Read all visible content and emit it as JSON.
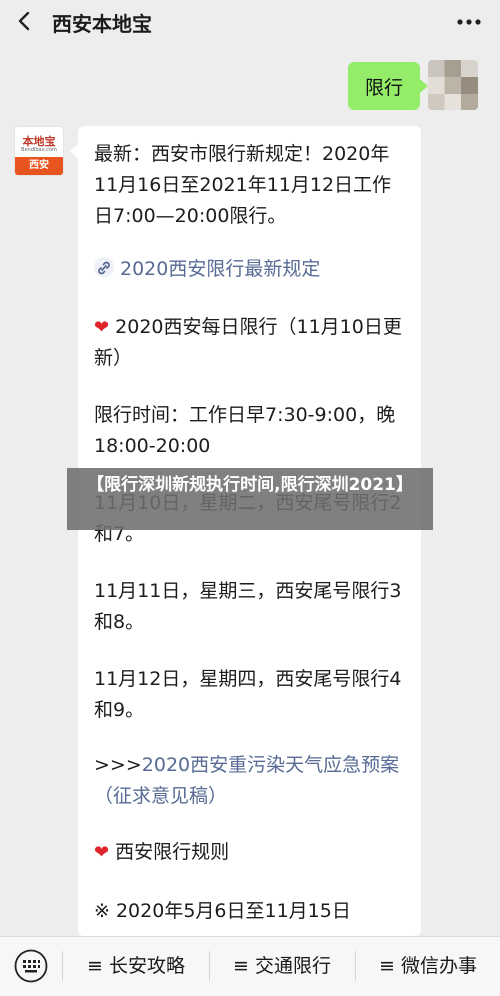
{
  "header": {
    "title": "西安本地宝",
    "back_icon": "chevron-left-icon",
    "more_icon": "more-dots-icon"
  },
  "outgoing": {
    "text": "限行"
  },
  "official_account": {
    "logo_text": "本地宝",
    "logo_sub": "Bendibao.com",
    "logo_city": "西安"
  },
  "message": {
    "intro": "最新：西安市限行新规定！2020年11月16日至2021年11月12日工作日7:00—20:00限行。",
    "link1": "2020西安限行最新规定",
    "daily_title": "2020西安每日限行（11月10日更新）",
    "time_label": "限行时间：工作日早7:30-9:00，晚18:00-20:00",
    "day1": "11月10日，星期二，西安尾号限行2和7。",
    "day2": "11月11日，星期三，西安尾号限行3和8。",
    "day3": "11月12日，星期四，西安尾号限行4和9。",
    "link2_prefix": ">>>",
    "link2": "2020西安重污染天气应急预案（征求意见稿）",
    "rules_title": "西安限行规则",
    "rules_note": "※ 2020年5月6日至11月15日"
  },
  "banner": {
    "text": "【限行深圳新规执行时间,限行深圳2021】"
  },
  "bottom_menu": {
    "keyboard_icon": "keyboard-icon",
    "items": [
      {
        "label": "≡ 长安攻略"
      },
      {
        "label": "≡ 交通限行"
      },
      {
        "label": "≡ 微信办事"
      }
    ]
  },
  "colors": {
    "background": "#ededed",
    "outgoing_bubble": "#95ec69",
    "link": "#576b95",
    "heart": "#e0242b",
    "brand": "#e8541e"
  }
}
